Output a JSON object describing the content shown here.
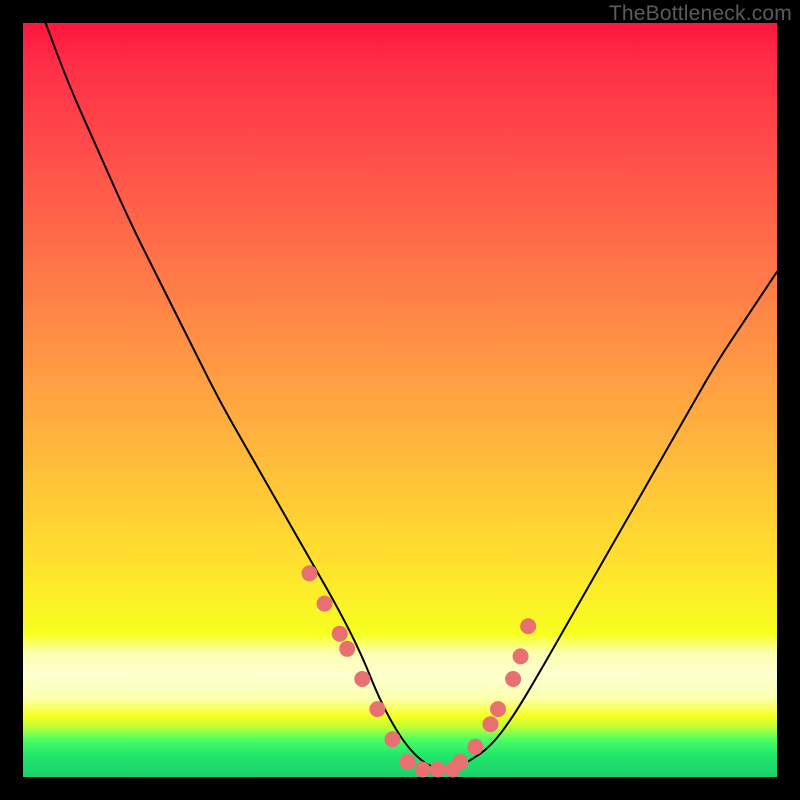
{
  "watermark": "TheBottleneck.com",
  "chart_data": {
    "type": "line",
    "title": "",
    "xlabel": "",
    "ylabel": "",
    "xlim": [
      0,
      100
    ],
    "ylim": [
      0,
      100
    ],
    "grid": false,
    "legend": false,
    "series": [
      {
        "name": "bottleneck-curve",
        "x": [
          3,
          6,
          10,
          14,
          18,
          22,
          26,
          30,
          34,
          38,
          42,
          45,
          47,
          49,
          51,
          53,
          55,
          57,
          59,
          62,
          65,
          68,
          72,
          76,
          80,
          84,
          88,
          92,
          96,
          100
        ],
        "values": [
          100,
          92,
          83,
          74,
          66,
          58,
          50,
          43,
          36,
          29,
          22,
          16,
          11,
          7,
          4,
          2,
          1,
          1,
          2,
          4,
          8,
          13,
          20,
          27,
          34,
          41,
          48,
          55,
          61,
          67
        ]
      }
    ],
    "highlight_points": {
      "name": "salmon-dots",
      "x": [
        38,
        40,
        42,
        43,
        45,
        47,
        49,
        51,
        53,
        55,
        57,
        58,
        60,
        62,
        63,
        65,
        66,
        67
      ],
      "values": [
        27,
        23,
        19,
        17,
        13,
        9,
        5,
        2,
        1,
        1,
        1,
        2,
        4,
        7,
        9,
        13,
        16,
        20
      ]
    },
    "gradient_stops": [
      {
        "pos": 0.0,
        "color": "#ff163f"
      },
      {
        "pos": 0.4,
        "color": "#ff8a46"
      },
      {
        "pos": 0.72,
        "color": "#ffe22e"
      },
      {
        "pos": 0.86,
        "color": "#fdffcf"
      },
      {
        "pos": 0.95,
        "color": "#4eff62"
      },
      {
        "pos": 1.0,
        "color": "#1ccf6a"
      }
    ]
  }
}
